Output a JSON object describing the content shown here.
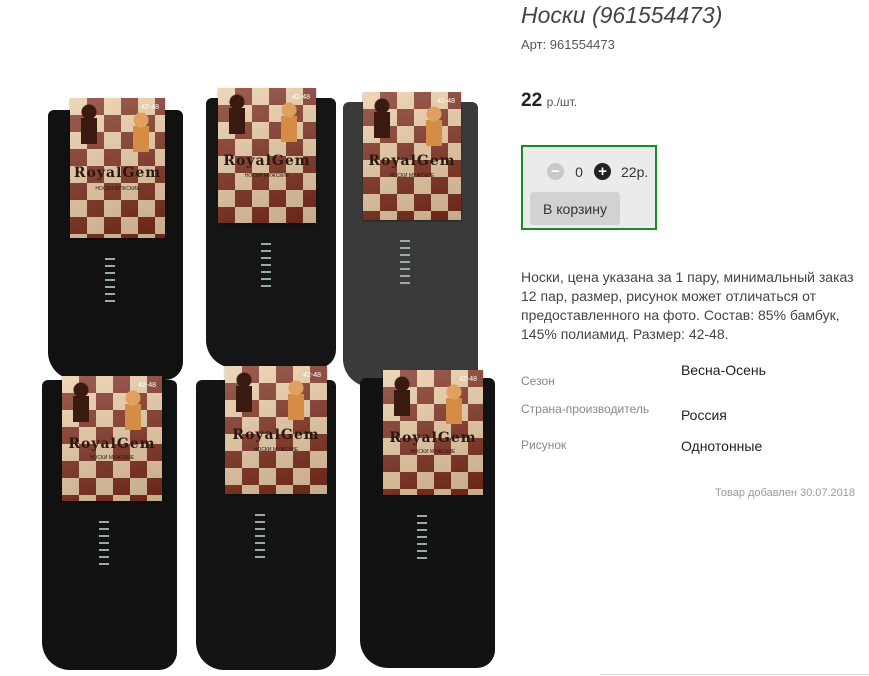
{
  "product": {
    "title": "Носки (961554473)",
    "article": "Арт: 961554473",
    "price_value": "22",
    "price_unit": "р./шт."
  },
  "cart": {
    "minus_icon": "minus-icon",
    "plus_icon": "plus-icon",
    "quantity": "0",
    "sum": "22р.",
    "button_label": "В корзину",
    "border_color": "#1a8a2a"
  },
  "description": "Носки, цена указана за 1 пару, минимальный заказ 12 пар, размер, рисунок может отличаться от предоставленного на фото. Состав: 85% бамбук, 145% полиамид. Размер: 42-48.",
  "properties": [
    {
      "key": "Сезон",
      "value": "Весна-Осень"
    },
    {
      "key": "Страна-производитель",
      "value": "Россия"
    },
    {
      "key": "Рисунок",
      "value": "Однотонные"
    }
  ],
  "added_note": "Товар добавлен 30.07.2018",
  "photo": {
    "brand": "RoyalGem",
    "card_subtitle": "НОСКИ МУЖСКИЕ",
    "size_label": "42-48",
    "sock_colors": [
      "#111111",
      "#151515",
      "#3a3a3a",
      "#111111",
      "#141414",
      "#121212"
    ]
  }
}
